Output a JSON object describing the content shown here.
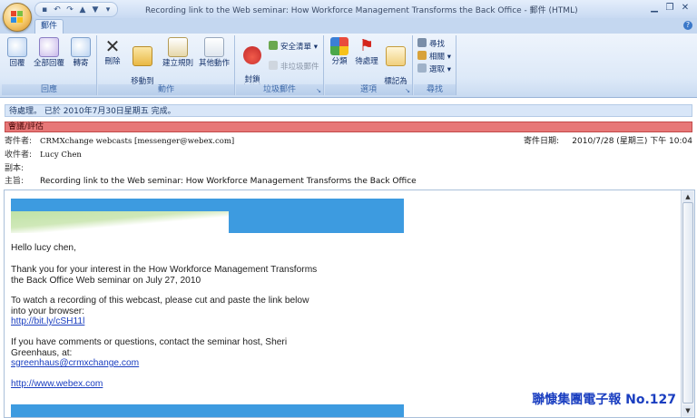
{
  "window": {
    "title": "Recording link to the  Web seminar: How Workforce Management Transforms the Back Office - 郵件 (HTML)",
    "tab": "郵件"
  },
  "ribbon": {
    "groups": {
      "respond": {
        "label": "回應",
        "reply": "回覆",
        "reply_all": "全部回覆",
        "forward": "轉寄"
      },
      "actions": {
        "label": "動作",
        "delete": "刪除",
        "move_to_folder": "移動到\n資料夾",
        "create_rule": "建立規則",
        "other_actions": "其他動作"
      },
      "junk": {
        "label": "垃圾郵件",
        "block_sender": "封鎖\n寄件者",
        "safe_lists": "安全清單",
        "not_junk": "非垃圾郵件"
      },
      "options": {
        "label": "選項",
        "categorize": "分類",
        "follow_up": "待處理",
        "mark_unread": "標記為\n未讀取"
      },
      "find": {
        "label": "尋找",
        "find": "尋找",
        "related": "相關",
        "select": "選取"
      }
    }
  },
  "message": {
    "info_bar": "待處理。 已於 2010年7月30日星期五 完成。",
    "category": "會議/評估",
    "from_label": "寄件者:",
    "from": "CRMXchange webcasts [messenger@webex.com]",
    "sent_label": "寄件日期:",
    "sent": "2010/7/28 (星期三) 下午 10:04",
    "to_label": "收件者:",
    "to": "Lucy Chen",
    "cc_label": "副本:",
    "cc": "",
    "subject_label": "主旨:",
    "subject": "Recording link to the  Web seminar: How Workforce Management Transforms the Back Office"
  },
  "email_body": {
    "greeting": "Hello lucy chen,",
    "p1_line1": "Thank you for your interest in the How Workforce Management Transforms",
    "p1_line2": "the Back Office Web seminar on July 27, 2010",
    "p2_line1": "To watch a recording of this webcast, please cut and paste the link below",
    "p2_line2": "into your browser:",
    "recording_link": "http://bit.ly/cSH11l",
    "p3_line1": "If you have comments or questions, contact the seminar host, Sheri",
    "p3_line2": "Greenhaus, at:",
    "host_email": "sgreenhaus@crmxchange.com",
    "webex_link": "http://www.webex.com"
  },
  "watermark": "聯慷集團電子報  No.127",
  "colors": {
    "banner_blue": "#3d9be0",
    "category_red": "#e77777",
    "link_blue": "#1a3ec0"
  },
  "icons": [
    "office-button",
    "save-icon",
    "undo-icon",
    "redo-icon",
    "up-icon",
    "down-icon",
    "minimize-icon",
    "restore-icon",
    "close-icon",
    "help-icon"
  ]
}
